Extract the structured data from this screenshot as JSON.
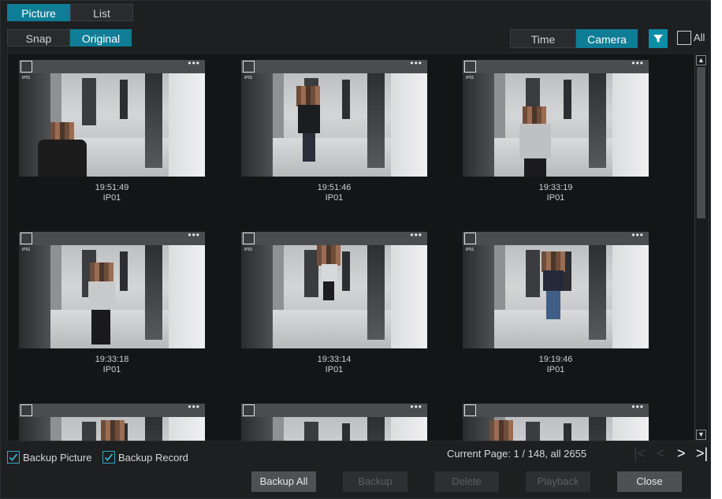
{
  "tabs": {
    "picture": "Picture",
    "list": "List"
  },
  "view": {
    "snap": "Snap",
    "original": "Original"
  },
  "sort": {
    "time": "Time",
    "camera": "Camera"
  },
  "filter": {
    "all_label": "All"
  },
  "cards": [
    {
      "time": "19:51:49",
      "camera": "IP01"
    },
    {
      "time": "19:51:46",
      "camera": "IP01"
    },
    {
      "time": "19:33:19",
      "camera": "IP01"
    },
    {
      "time": "19:33:18",
      "camera": "IP01"
    },
    {
      "time": "19:33:14",
      "camera": "IP01"
    },
    {
      "time": "19:19:46",
      "camera": "IP01"
    }
  ],
  "card_menu": "•••",
  "bottom": {
    "backup_picture": "Backup Picture",
    "backup_record": "Backup Record",
    "page_info": "Current Page: 1 / 148, all 2655"
  },
  "pager": {
    "first": "|<",
    "prev": "<",
    "next": ">",
    "last": ">|"
  },
  "buttons": {
    "backup_all": "Backup All",
    "backup": "Backup",
    "delete": "Delete",
    "playback": "Playback",
    "close": "Close"
  },
  "colors": {
    "accent": "#0e7d95",
    "panel": "#1e1f21",
    "grid_bg": "#141517"
  }
}
